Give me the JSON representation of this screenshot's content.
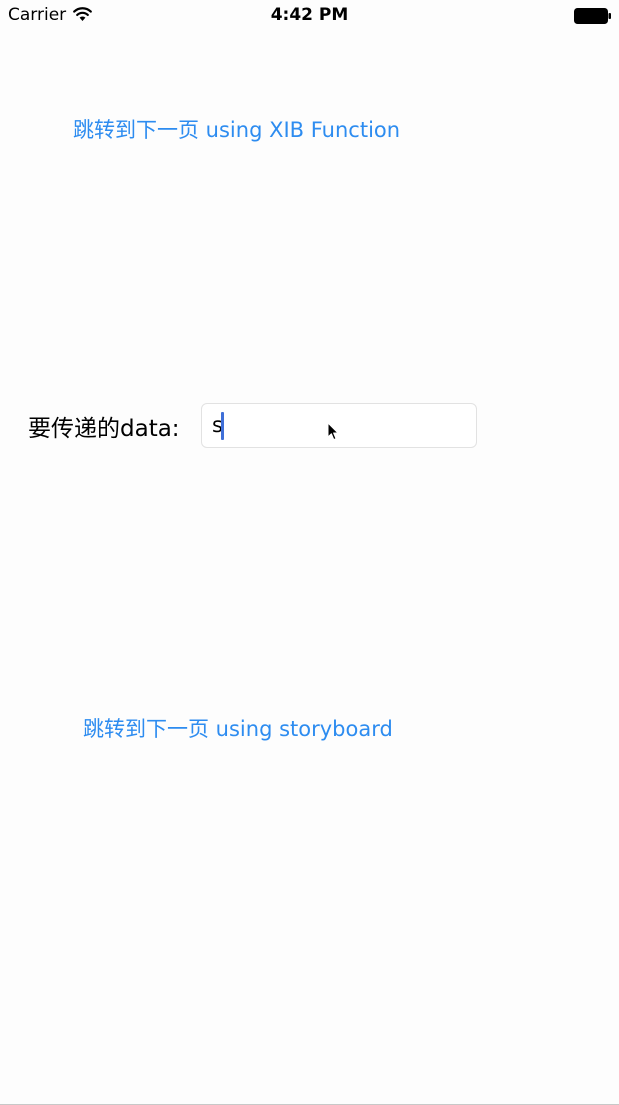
{
  "status_bar": {
    "carrier": "Carrier",
    "time": "4:42 PM",
    "icons": [
      "wifi-icon",
      "battery-icon"
    ]
  },
  "main": {
    "xib_button_label": "跳转到下一页 using XIB Function",
    "data_label": "要传递的data:",
    "data_field_value": "s",
    "storyboard_button_label": "跳转到下一页 using storyboard"
  },
  "colors": {
    "link": "#2d8cf0",
    "background": "#fdfdfd",
    "caret": "#3f6fd8"
  }
}
